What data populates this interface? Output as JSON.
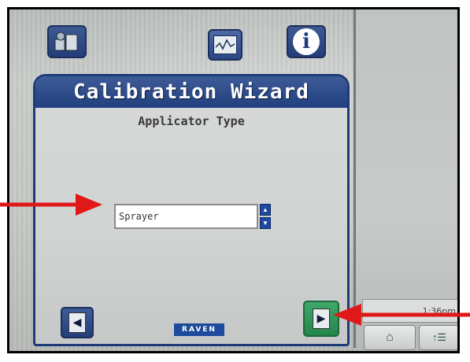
{
  "toolbar": {
    "tools_icon": "tools-icon",
    "chart_icon": "chart-icon",
    "info_icon": "info-icon",
    "info_glyph": "i"
  },
  "wizard": {
    "title": "Calibration Wizard",
    "subtitle": "Applicator Type",
    "selected_value": "Sprayer",
    "back_glyph": "◀",
    "next_glyph": "▶",
    "brand": "RAVEN"
  },
  "status": {
    "time": "1:36pm",
    "home_glyph": "⌂",
    "layers_glyph": "↑☰"
  },
  "colors": {
    "header_blue": "#22407e",
    "next_green": "#23864a",
    "annotation_red": "#e11818"
  }
}
